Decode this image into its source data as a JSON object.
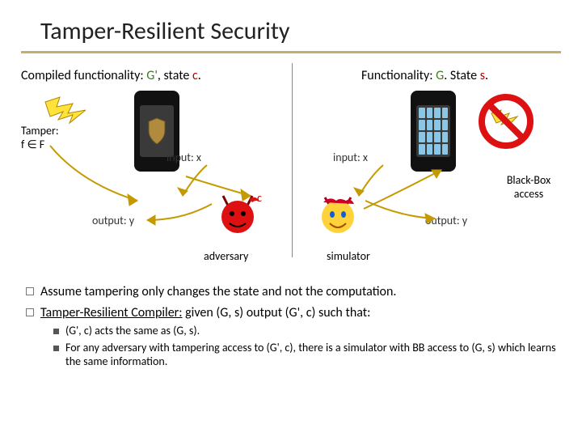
{
  "title": "Tamper-Resilient Security",
  "left_header": "Compiled functionality: <span class='green'>G'</span>, state <span class='red'>c</span>.",
  "right_header": "Functionality: <span class='green'>G</span>. State <span class='red'>s</span>.",
  "tamper": "Tamper:<br>f ∈ F",
  "input_x": "input: x",
  "output_y": "output: y",
  "c": "c",
  "adversary": "adversary",
  "simulator": "simulator",
  "bb": "Black-Box<br>access",
  "bullets": {
    "b1": "Assume tampering only changes the state and not the computation.",
    "b2": "<span class='underline'>Tamper-Resilient Compiler:</span> given (G, s) output (G', c) such that:",
    "s1": "(G', c) acts the same as (G, s).",
    "s2": "For any adversary with tampering access to (G', c), there is a simulator with BB access to (G, s) which learns the same information."
  }
}
